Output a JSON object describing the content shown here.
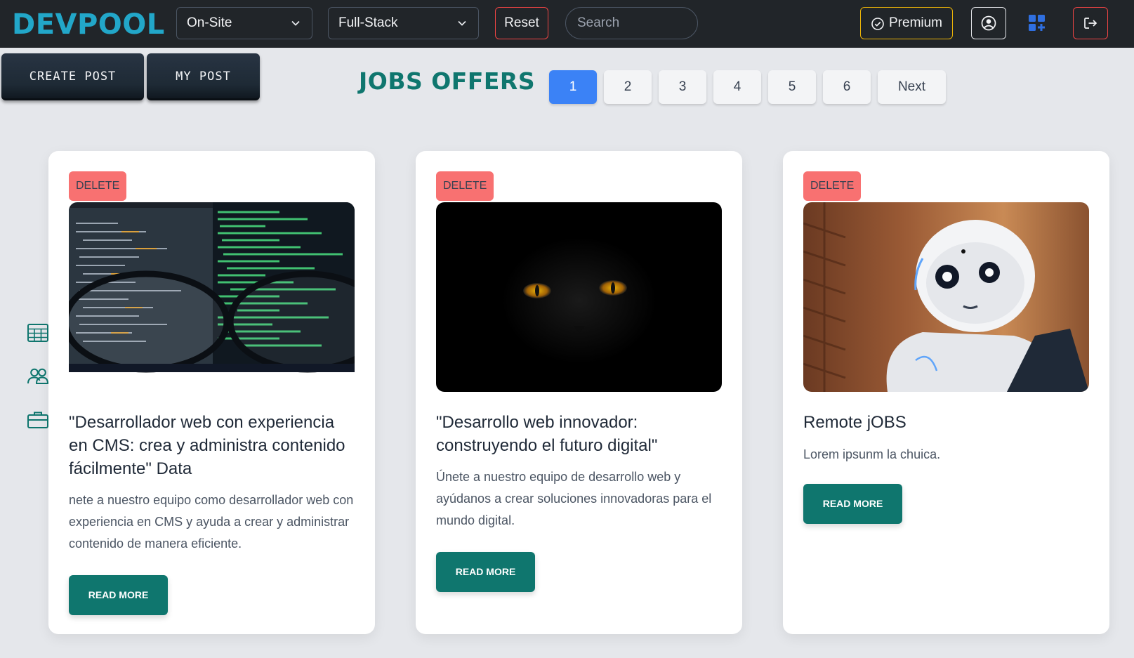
{
  "app": {
    "logo": "DEVPOOL"
  },
  "filters": {
    "location_value": "On-Site",
    "role_value": "Full-Stack",
    "reset_label": "Reset",
    "search_placeholder": "Search"
  },
  "header_actions": {
    "premium_label": "Premium"
  },
  "toolbar": {
    "create_post_label": "CREATE POST",
    "my_post_label": "MY POST"
  },
  "main": {
    "title": "JOBS OFFERS"
  },
  "pagination": {
    "pages": [
      "1",
      "2",
      "3",
      "4",
      "5",
      "6"
    ],
    "active": "1",
    "next_label": "Next"
  },
  "sidebar_icons": [
    "table-icon",
    "users-icon",
    "briefcase-icon"
  ],
  "cards": [
    {
      "delete_label": "DELETE",
      "image": "code-screen-glasses-image",
      "title": "\"Desarrollador web con experiencia en CMS: crea y administra contenido fácilmente\" Data",
      "text": "nete a nuestro equipo como desarrollador web con experiencia en CMS y ayuda a crear y administrar contenido de manera eficiente.",
      "button_label": "READ MORE"
    },
    {
      "delete_label": "DELETE",
      "image": "black-cat-yellow-eyes-image",
      "title": "\"Desarrollo web innovador: construyendo el futuro digital\"",
      "text": "Únete a nuestro equipo de desarrollo web y ayúdanos a crear soluciones innovadoras para el mundo digital.",
      "button_label": "READ MORE"
    },
    {
      "delete_label": "DELETE",
      "image": "white-robot-image",
      "title": "Remote jOBS",
      "text": "Lorem ipsunm la chuica.",
      "button_label": "READ MORE"
    }
  ],
  "colors": {
    "navbar": "#212529",
    "logo": "#22a7c9",
    "accent": "#0f766e",
    "page_active": "#3b82f6",
    "delete": "#f87171",
    "premium_border": "#eab308"
  }
}
